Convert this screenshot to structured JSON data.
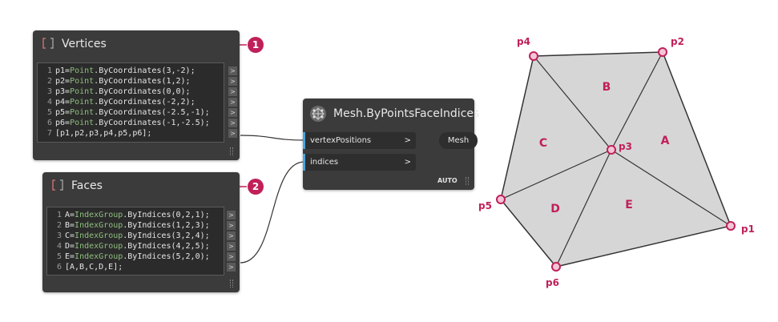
{
  "vertices_node": {
    "title": "Vertices",
    "badge": "1",
    "lines": [
      {
        "n": "1",
        "a": "p1=",
        "c": "Point",
        "b": ".ByCoordinates(3,-2);"
      },
      {
        "n": "2",
        "a": "p2=",
        "c": "Point",
        "b": ".ByCoordinates(1,2);"
      },
      {
        "n": "3",
        "a": "p3=",
        "c": "Point",
        "b": ".ByCoordinates(0,0);"
      },
      {
        "n": "4",
        "a": "p4=",
        "c": "Point",
        "b": ".ByCoordinates(-2,2);"
      },
      {
        "n": "5",
        "a": "p5=",
        "c": "Point",
        "b": ".ByCoordinates(-2.5,-1);"
      },
      {
        "n": "6",
        "a": "p6=",
        "c": "Point",
        "b": ".ByCoordinates(-1,-2.5);"
      },
      {
        "n": "7",
        "a": "[p1,p2,p3,p4,p5,p6];",
        "c": "",
        "b": ""
      }
    ]
  },
  "faces_node": {
    "title": "Faces",
    "badge": "2",
    "lines": [
      {
        "n": "1",
        "a": "A=",
        "c": "IndexGroup",
        "b": ".ByIndices(0,2,1);"
      },
      {
        "n": "2",
        "a": "B=",
        "c": "IndexGroup",
        "b": ".ByIndices(1,2,3);"
      },
      {
        "n": "3",
        "a": "C=",
        "c": "IndexGroup",
        "b": ".ByIndices(3,2,4);"
      },
      {
        "n": "4",
        "a": "D=",
        "c": "IndexGroup",
        "b": ".ByIndices(4,2,5);"
      },
      {
        "n": "5",
        "a": "E=",
        "c": "IndexGroup",
        "b": ".ByIndices(5,2,0);"
      },
      {
        "n": "6",
        "a": "[A,B,C,D,E];",
        "c": "",
        "b": ""
      }
    ]
  },
  "mesh_node": {
    "title": "Mesh.ByPointsFaceIndices",
    "inputs": [
      {
        "label": "vertexPositions",
        "arrow": ">"
      },
      {
        "label": "indices",
        "arrow": ">"
      }
    ],
    "output": "Mesh",
    "lacing": "AUTO"
  },
  "port_arrow": ">",
  "mesh_diagram": {
    "points": [
      {
        "label": "p4"
      },
      {
        "label": "p2"
      },
      {
        "label": "p3"
      },
      {
        "label": "p5"
      },
      {
        "label": "p1"
      },
      {
        "label": "p6"
      }
    ],
    "faces": [
      "A",
      "B",
      "C",
      "D",
      "E"
    ],
    "colors": {
      "fill": "#d6d6d6",
      "stroke": "#333333",
      "accent": "#c0205a",
      "vertex_fill": "#f2c6d6"
    }
  }
}
